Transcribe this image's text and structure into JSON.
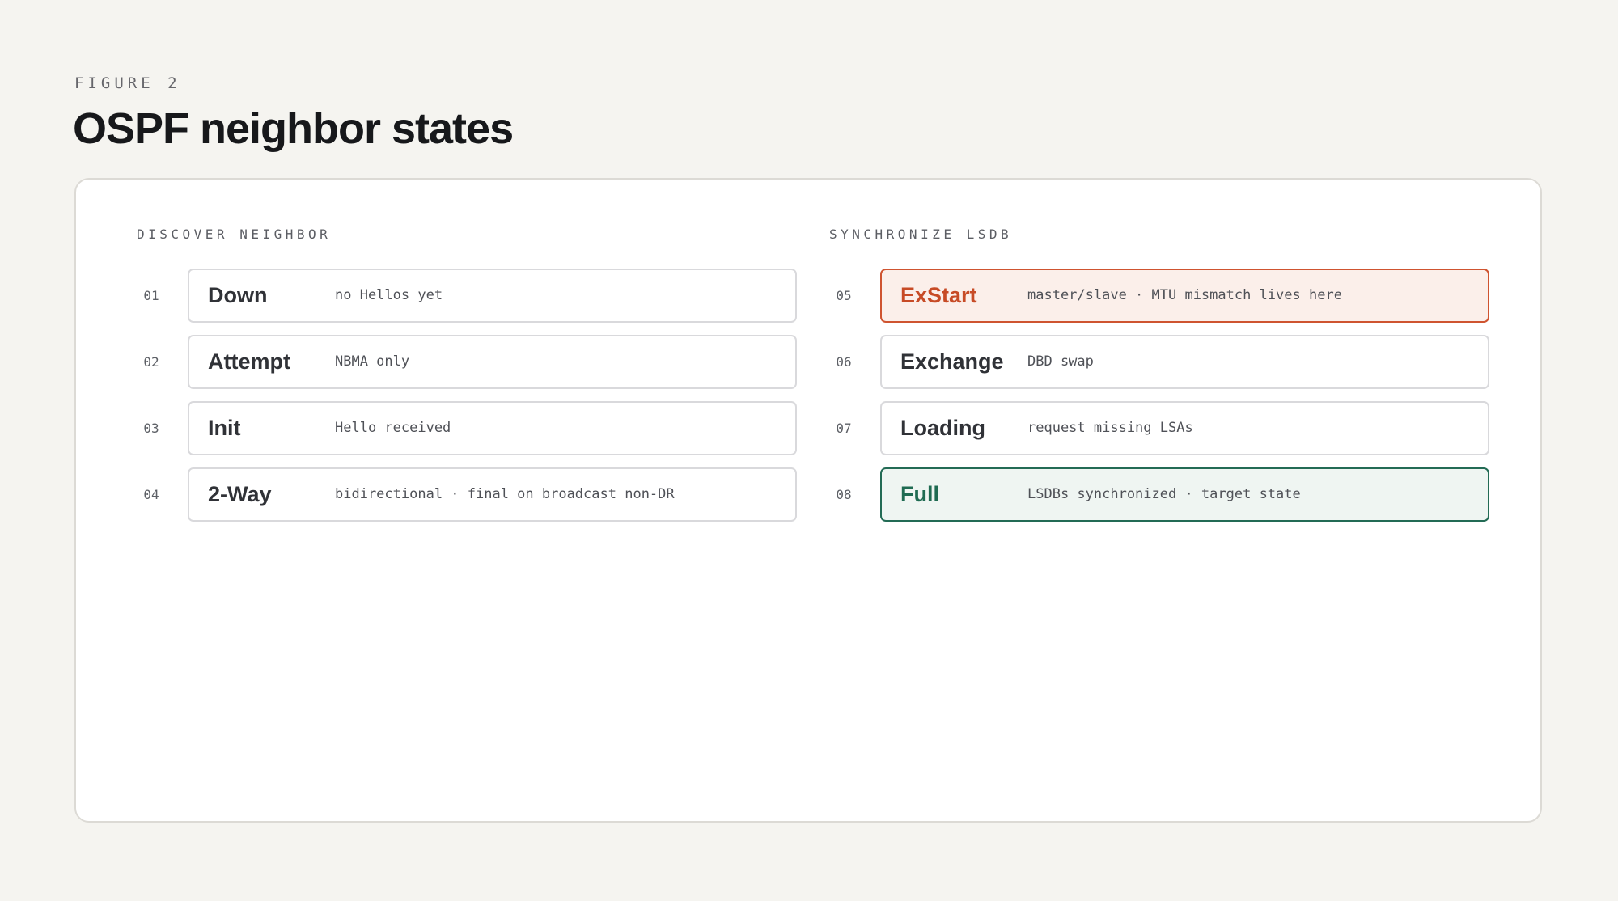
{
  "figure": {
    "eyebrow": "FIGURE 2",
    "title": "OSPF neighbor states"
  },
  "colors": {
    "background": "#f5f4f0",
    "card": "#ffffff",
    "warn_accent": "#c74b26",
    "warn_fill": "#fbefea",
    "ok_accent": "#1f6b52",
    "ok_fill": "#eff5f2"
  },
  "groups": [
    {
      "heading": "DISCOVER NEIGHBOR",
      "states": [
        {
          "num": "01",
          "name": "Down",
          "desc": "no Hellos yet",
          "tone": "normal"
        },
        {
          "num": "02",
          "name": "Attempt",
          "desc": "NBMA only",
          "tone": "normal"
        },
        {
          "num": "03",
          "name": "Init",
          "desc": "Hello received",
          "tone": "normal"
        },
        {
          "num": "04",
          "name": "2-Way",
          "desc": "bidirectional · final on broadcast non-DR",
          "tone": "normal"
        }
      ]
    },
    {
      "heading": "SYNCHRONIZE LSDB",
      "states": [
        {
          "num": "05",
          "name": "ExStart",
          "desc": "master/slave · MTU mismatch lives here",
          "tone": "warn"
        },
        {
          "num": "06",
          "name": "Exchange",
          "desc": "DBD swap",
          "tone": "normal"
        },
        {
          "num": "07",
          "name": "Loading",
          "desc": "request missing LSAs",
          "tone": "normal"
        },
        {
          "num": "08",
          "name": "Full",
          "desc": "LSDBs synchronized · target state",
          "tone": "ok"
        }
      ]
    }
  ]
}
